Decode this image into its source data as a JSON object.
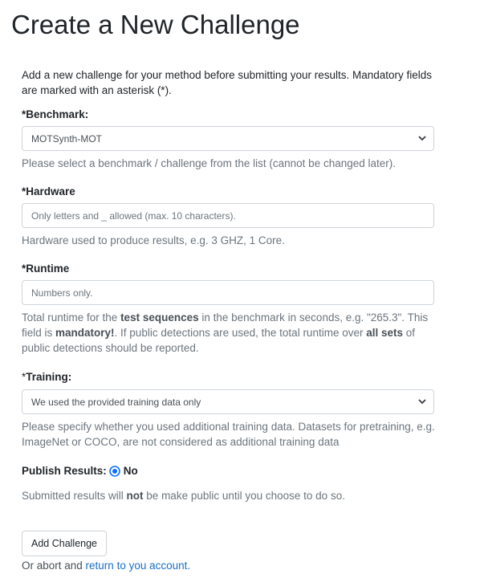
{
  "title": "Create a New Challenge",
  "intro": "Add a new challenge for your method before submitting your results. Mandatory fields are marked with an asterisk (*).",
  "benchmark": {
    "label": "Benchmark:",
    "selected": "MOTSynth-MOT",
    "help": "Please select a benchmark / challenge from the list (cannot be changed later)."
  },
  "hardware": {
    "label": "Hardware",
    "placeholder": "Only letters and _ allowed (max. 10 characters).",
    "help": "Hardware used to produce results, e.g. 3 GHZ, 1 Core."
  },
  "runtime": {
    "label": "Runtime",
    "placeholder": "Numbers only.",
    "help_1": "Total runtime for the ",
    "help_bold_1": "test sequences",
    "help_2": " in the benchmark in seconds, e.g. \"265.3\". This field is ",
    "help_bold_2": "mandatory!",
    "help_3": ". If public detections are used, the total runtime over ",
    "help_bold_3": "all sets",
    "help_4": " of public detections should be reported."
  },
  "training": {
    "label": "Training:",
    "selected": "We used the provided training data only",
    "help": "Please specify whether you used additional training data. Datasets for pretraining, e.g. ImageNet or COCO, are not considered as additional training data"
  },
  "publish": {
    "label": "Publish Results:",
    "option": "No",
    "help_1": "Submitted results will ",
    "help_bold": "not",
    "help_2": " be make public until you choose to do so."
  },
  "add_button": "Add Challenge",
  "abort": {
    "text": "Or abort and ",
    "link": "return to you account."
  },
  "asterisk": "*",
  "colors": {
    "accent": "#0d6efd",
    "link": "#1a6fc4",
    "muted": "#6c757d",
    "border": "#ced4da"
  }
}
